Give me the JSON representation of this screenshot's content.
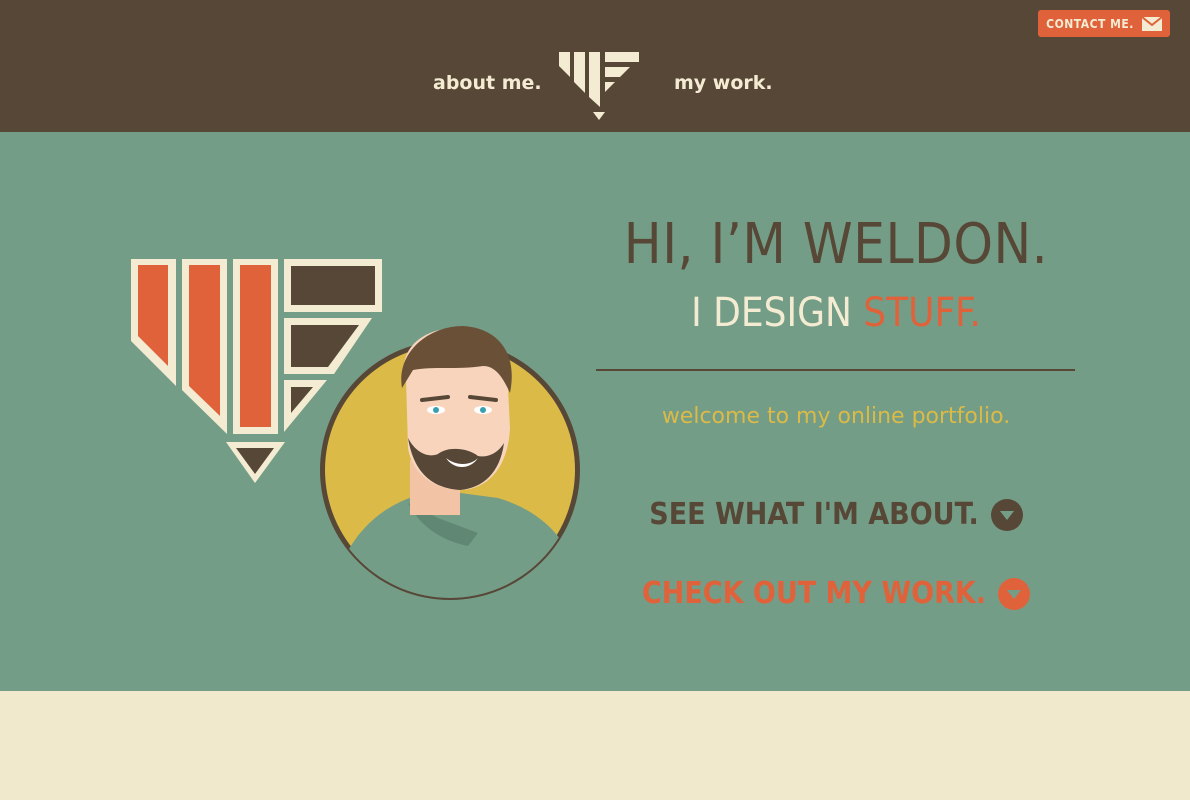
{
  "nav": {
    "about_label": "about me.",
    "work_label": "my work.",
    "contact_label": "CONTACT ME."
  },
  "hero": {
    "title_line1": "HI, I’M WELDON.",
    "title_line2_prefix": "I DESIGN ",
    "title_line2_accent": "STUFF.",
    "welcome": "welcome to my online portfolio.",
    "cta_about": "SEE WHAT I'M ABOUT.",
    "cta_work": "CHECK OUT MY WORK."
  },
  "icons": {
    "logo": "wf-monogram-logo",
    "contact": "envelope-icon",
    "cta": "chevron-down-circle-icon"
  },
  "colors": {
    "header_bg": "#574737",
    "hero_bg": "#749d87",
    "footer_bg": "#f1e9cb",
    "accent": "#e0623b",
    "cream": "#f4ecd2",
    "gold": "#dbba47"
  }
}
